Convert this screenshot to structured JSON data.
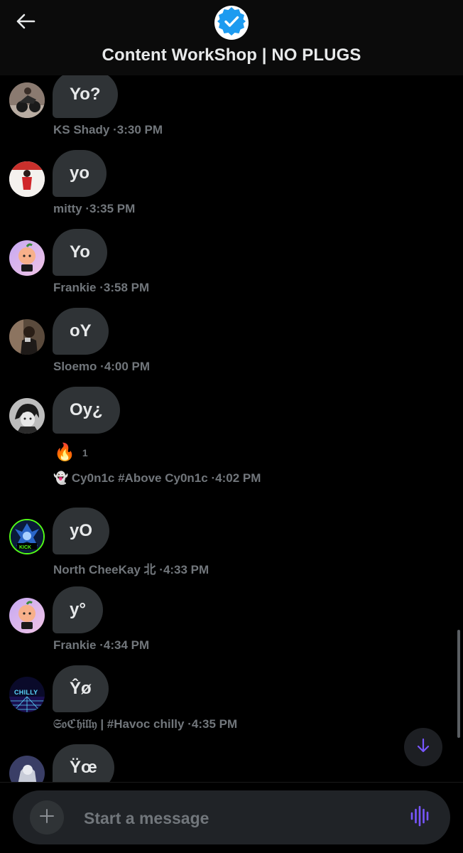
{
  "header": {
    "title": "Content WorkShop | NO PLUGS",
    "back_icon": "arrow-left-icon",
    "verified_icon": "verified-badge-icon",
    "verified_color": "#1d9bf0"
  },
  "messages": [
    {
      "text": "Yo?",
      "author": "KS Shady",
      "time": "3:30 PM"
    },
    {
      "text": "yo",
      "author": "mitty",
      "time": "3:35 PM"
    },
    {
      "text": "Yo",
      "author": "Frankie",
      "time": "3:58 PM"
    },
    {
      "text": "oY",
      "author": "Sloemo",
      "time": "4:00 PM"
    },
    {
      "text": "Oy¿",
      "author": "👻 Cy0n1c #Above Cy0n1c",
      "time": "4:02 PM",
      "reaction": {
        "emoji": "🔥",
        "count": "1"
      }
    },
    {
      "text": "yO",
      "author": "North CheeKay 北",
      "time": "4:33 PM"
    },
    {
      "text": "y°",
      "author": "Frankie",
      "time": "4:34 PM"
    },
    {
      "text": "Ŷø",
      "author": "𝔖𝔬ℭ𝔥𝔦𝔩𝔩𝔶 | #Havoc chilly",
      "time": "4:35 PM"
    },
    {
      "text": "Ÿœ"
    }
  ],
  "avatars": {
    "ks_shady": "avatar-photo",
    "mitty": "avatar-red-figure",
    "frankie": "avatar-peach-character",
    "sloemo": "avatar-mirror-selfie",
    "cyonic": "avatar-anime-boy",
    "north_cheekay_badge": "KICK",
    "chilly_badge": "CHILLY"
  },
  "separator": "·",
  "composer": {
    "placeholder": "Start a message",
    "add_icon": "plus-icon",
    "voice_icon": "voice-waveform-icon",
    "voice_color": "#7856ff"
  },
  "scroll_down_icon": "arrow-down-icon",
  "scroll_down_color": "#7856ff"
}
